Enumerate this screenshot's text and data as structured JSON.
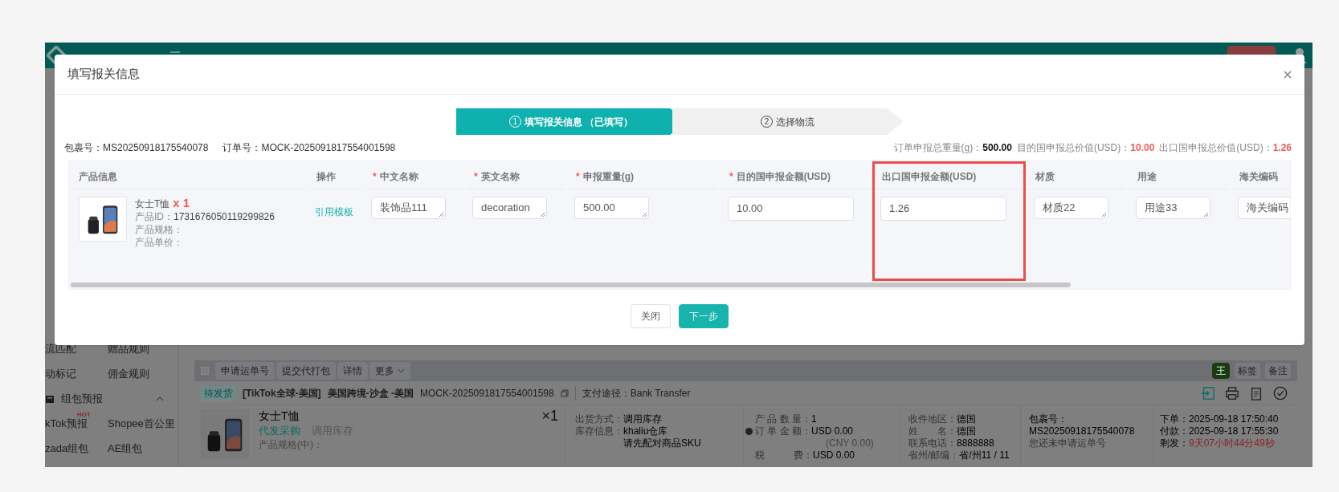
{
  "sidebar": {
    "rows": [
      {
        "left": "流匹配",
        "right": "赠品规则"
      },
      {
        "left": "动标记",
        "right": "佣金规则"
      }
    ],
    "group": {
      "label": "组包预报",
      "expanded": true
    },
    "group_rows": [
      {
        "left": "kTok预报",
        "badge": "HOT",
        "right": "Shopee首公里"
      },
      {
        "left": "zada组包",
        "right": "AE组包"
      }
    ]
  },
  "toolbar": {
    "checked": false,
    "buttons": [
      "申请运单号",
      "提交代打包",
      "详情",
      "更多"
    ],
    "user": "王",
    "tag": "标签",
    "note": "备注"
  },
  "order": {
    "status": "待发货",
    "store": "[TikTok全球-美国]",
    "shop": "美国跨境-沙盒 -美国",
    "order_no": "MOCK-2025091817554001598",
    "payment": "支付途径：Bank Transfer",
    "product": {
      "name": "女士T恤",
      "qty": "×1",
      "purchase": "代发采购",
      "stock": "调用库存",
      "spec": "产品规格(中)："
    },
    "shipping": [
      {
        "label": "出货方式：",
        "value": "调用库存"
      },
      {
        "label": "库存信息：",
        "value": "khaliu仓库"
      },
      {
        "value": "请先配对商品SKU"
      }
    ],
    "amounts": [
      {
        "kind": "plain",
        "label": "产 品 数 量：",
        "value": "1"
      },
      {
        "kind": "help",
        "label": "订 单 金 额：",
        "value": "USD 0.00"
      },
      {
        "kind": "sub",
        "value": "(CNY 0.00)"
      },
      {
        "kind": "plain",
        "label": "税　　　费：",
        "value": "USD 0.00"
      }
    ],
    "recipient": [
      {
        "label": "收件地区：",
        "value": "德国"
      },
      {
        "label": "姓　　名：",
        "value": "德国"
      },
      {
        "label": "联系电话：",
        "value": "8888888"
      },
      {
        "label": "省州/邮编：",
        "value": "省/州11 / 11"
      }
    ],
    "package": {
      "label": "包裹号：",
      "number": "MS20250918175540078",
      "note": "您还未申请运单号"
    },
    "times": [
      {
        "label": "下单：",
        "value": "2025-09-18 17:50:40"
      },
      {
        "label": "付款：",
        "value": "2025-09-18 17:55:30"
      }
    ],
    "remaining": {
      "label": "剩发：",
      "value": "9天07小时44分49秒"
    }
  },
  "dialog": {
    "title": "填写报关信息",
    "steps": [
      {
        "number": "1",
        "label": "填写报关信息 （已填写）",
        "selected": true
      },
      {
        "number": "2",
        "label": "选择物流",
        "selected": false
      }
    ],
    "package_label": "包裹号：",
    "package_no": "MS20250918175540078",
    "order_label": "订单号：",
    "order_no": "MOCK-2025091817554001598",
    "totals": [
      {
        "label": "订单申报总重量(g)：",
        "value": "500.00",
        "highlight": false
      },
      {
        "label": "目的国申报总价值(USD)：",
        "value": "10.00",
        "highlight": true
      },
      {
        "label": "出口国申报总价值(USD)：",
        "value": "1.26",
        "highlight": true
      }
    ],
    "columns": [
      {
        "label": "产品信息",
        "highlighted": false
      },
      {
        "label": "操作",
        "highlighted": false
      },
      {
        "required_mark": "*",
        "label": "中文名称",
        "highlighted": false
      },
      {
        "required_mark": "*",
        "label": "英文名称",
        "highlighted": false
      },
      {
        "required_mark": "*",
        "label": "申报重量(g)",
        "highlighted": false
      },
      {
        "required_mark": "*",
        "label": "目的国申报金额(USD)",
        "highlighted": false
      },
      {
        "label": "出口国申报金额(USD)",
        "highlighted": true
      },
      {
        "label": "材质",
        "highlighted": false
      },
      {
        "label": "用途",
        "highlighted": false
      },
      {
        "label": "海关编码",
        "highlighted": false
      }
    ],
    "row": {
      "product": {
        "name": "女士T恤",
        "qty": "x 1",
        "id_label": "产品ID：",
        "id": "1731676050119299826",
        "spec_label": "产品规格：",
        "price_label": "产品单价："
      },
      "action": "引用模板",
      "fields": [
        {
          "value": "装饰品111",
          "kind": "textarea"
        },
        {
          "value": "decoration",
          "kind": "textarea"
        },
        {
          "value": "500.00",
          "kind": "textarea"
        },
        {
          "value": "10.00",
          "kind": "input"
        },
        {
          "value": "1.26",
          "kind": "input"
        },
        {
          "value": "材质22",
          "kind": "textarea"
        },
        {
          "value": "用途33",
          "kind": "textarea"
        },
        {
          "value": "海关编码",
          "kind": "textarea"
        }
      ]
    },
    "buttons": [
      {
        "label": "关闭",
        "primary": false
      },
      {
        "label": "下一步",
        "primary": true
      }
    ]
  }
}
